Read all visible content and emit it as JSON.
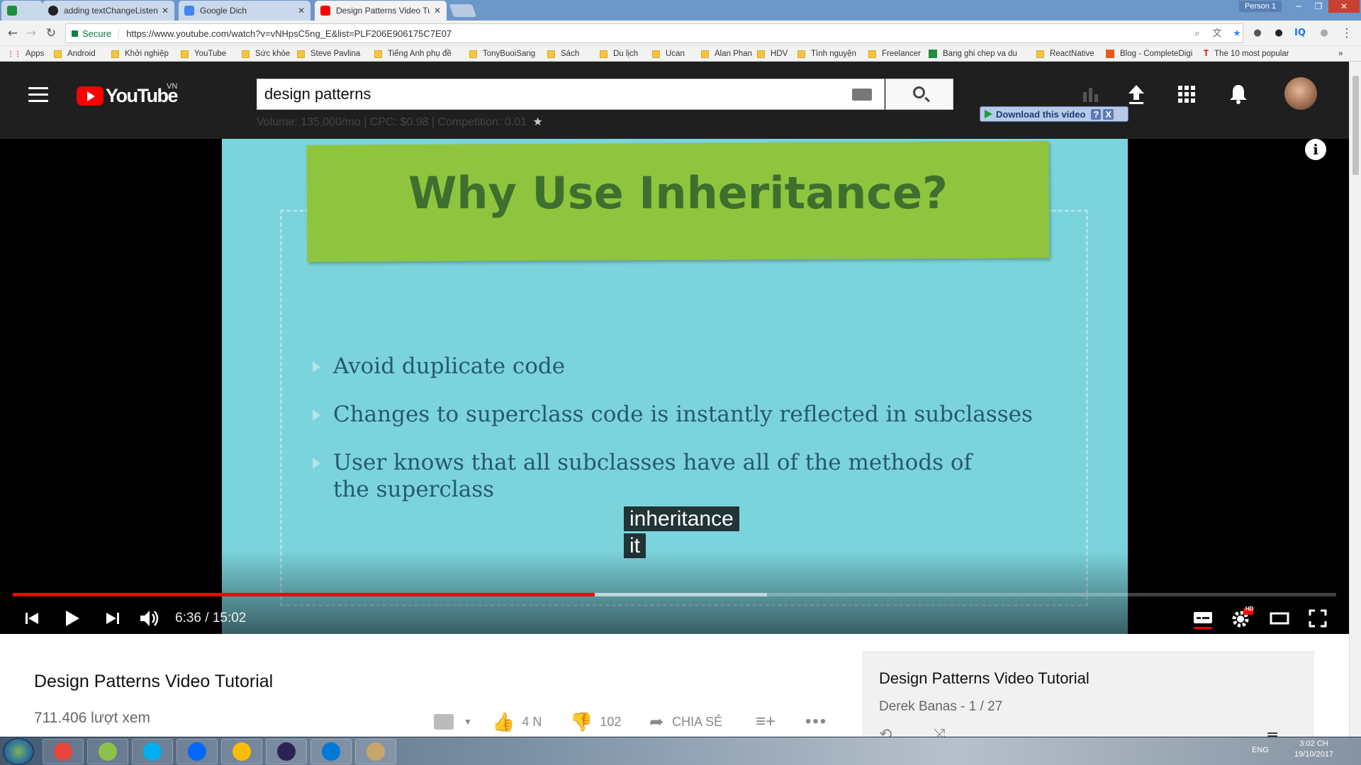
{
  "browser": {
    "tabs": [
      {
        "label": "",
        "icon": "sheets-icon",
        "color": "#1e8e3e"
      },
      {
        "label": "adding textChangeListen",
        "icon": "github-icon",
        "color": "#222222"
      },
      {
        "label": "Google Dich",
        "icon": "translate-icon",
        "color": "#4285f4"
      },
      {
        "label": "Design Patterns Video Tu",
        "icon": "youtube-icon",
        "color": "#ff0000"
      }
    ],
    "person": "Person 1",
    "secure_label": "Secure",
    "url": "https://www.youtube.com/watch?v=vNHpsC5ng_E&list=PLF206E906175C7E07",
    "bookmarks": [
      {
        "label": "Apps",
        "type": "apps"
      },
      {
        "label": "Android",
        "type": "folder"
      },
      {
        "label": "Khởi nghiệp",
        "type": "folder"
      },
      {
        "label": "YouTube",
        "type": "folder"
      },
      {
        "label": "Sức khỏe",
        "type": "folder"
      },
      {
        "label": "Steve Pavlina",
        "type": "folder"
      },
      {
        "label": "Tiếng Anh phụ đề",
        "type": "folder"
      },
      {
        "label": "TonyBuoiSang",
        "type": "folder"
      },
      {
        "label": "Sách",
        "type": "folder"
      },
      {
        "label": "Du lịch",
        "type": "folder"
      },
      {
        "label": "Ucan",
        "type": "folder"
      },
      {
        "label": "Alan Phan",
        "type": "folder"
      },
      {
        "label": "HDV",
        "type": "folder"
      },
      {
        "label": "Tình nguyện",
        "type": "folder"
      },
      {
        "label": "Freelancer",
        "type": "folder"
      },
      {
        "label": "Bang ghi chep va du",
        "type": "sheet"
      },
      {
        "label": "ReactNative",
        "type": "folder"
      },
      {
        "label": "Blog - CompleteDigi",
        "type": "blog"
      },
      {
        "label": "The 10 most popular",
        "type": "page"
      }
    ]
  },
  "youtube": {
    "logo_text": "YouTube",
    "region": "VN",
    "search_value": "design patterns",
    "keyword_stats": "Volume: 135,000/mo | CPC: $0.98 | Competition: 0.01",
    "download_label": "Download this video",
    "download_help": "?",
    "download_close": "X"
  },
  "slide": {
    "title": "Why Use Inheritance?",
    "bullets": [
      "Avoid duplicate code",
      "Changes to superclass code is instantly reflected in subclasses",
      "User knows that all subclasses have all of the methods of the superclass"
    ]
  },
  "captions": [
    "inheritance",
    "it"
  ],
  "player": {
    "current_time": "6:36",
    "duration": "15:02",
    "time_display": "6:36 / 15:02",
    "progress_fraction": 0.44,
    "buffered_fraction": 0.57,
    "hd_badge": "HD"
  },
  "video": {
    "title": "Design Patterns Video Tutorial",
    "views": "711.406 lượt xem",
    "likes": "4 N",
    "dislikes": "102",
    "share_label": "CHIA SẺ"
  },
  "playlist": {
    "title": "Design Patterns Video Tutorial",
    "subtitle": "Derek Banas - 1 / 27"
  },
  "taskbar": {
    "apps": [
      "chrome-icon",
      "notepad-icon",
      "skype-icon",
      "zalo-icon",
      "chrome-profile-icon",
      "eclipse-icon",
      "vscode-icon",
      "paint-icon"
    ],
    "language": "ENG",
    "time": "3:02 CH",
    "date": "19/10/2017"
  },
  "colors": {
    "youtube_red": "#ff0000",
    "header_bg": "#1f1f1f",
    "slide_bg": "#7bd3dc",
    "banner_green": "#8fc43e"
  }
}
